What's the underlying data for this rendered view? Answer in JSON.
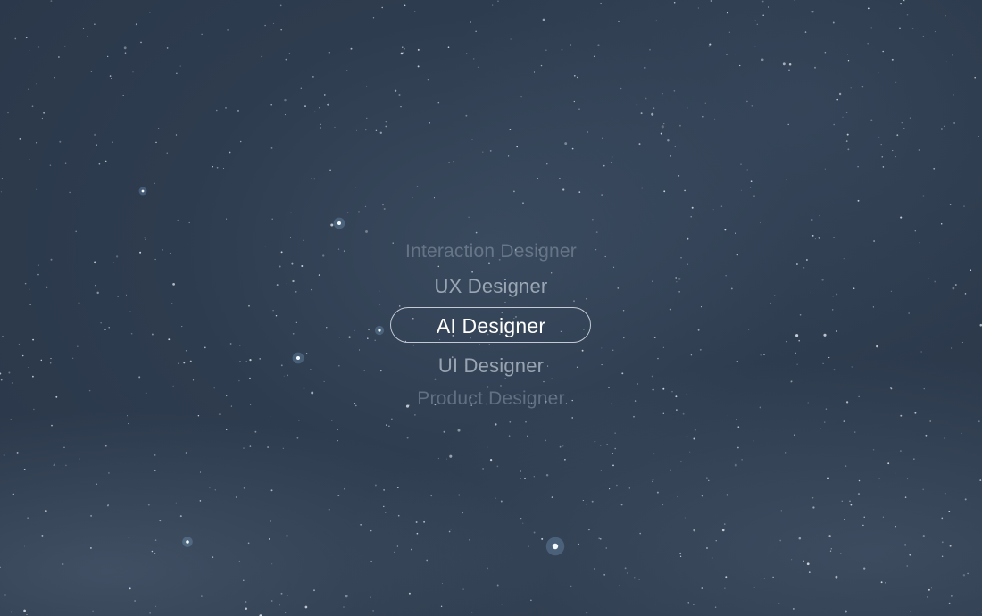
{
  "picker": {
    "items": [
      {
        "label": "Interaction Designer"
      },
      {
        "label": "UX Designer"
      },
      {
        "label": "AI Designer"
      },
      {
        "label": "UI Designer"
      },
      {
        "label": "Product Designer"
      }
    ],
    "selected_index": 2
  },
  "colors": {
    "background": "#2e3c4f",
    "selected_text": "#ffffff",
    "selection_border": "#ebf0f8"
  }
}
